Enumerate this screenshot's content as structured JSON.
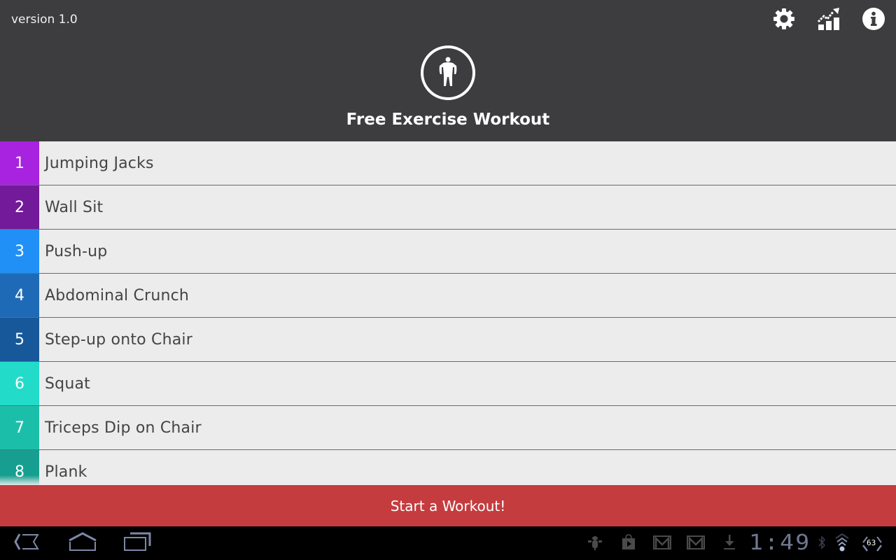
{
  "header": {
    "version": "version 1.0",
    "title": "Free Exercise Workout",
    "icons": [
      "settings-gear-icon",
      "progress-chart-icon",
      "info-icon"
    ],
    "logo_icon": "body-figure-icon",
    "background": "#3d3d3f"
  },
  "exercises": [
    {
      "number": "1",
      "name": "Jumping Jacks",
      "color": "#a723e0"
    },
    {
      "number": "2",
      "name": "Wall Sit",
      "color": "#721a9a"
    },
    {
      "number": "3",
      "name": "Push-up",
      "color": "#2090f7"
    },
    {
      "number": "4",
      "name": "Abdominal Crunch",
      "color": "#1f6ab6"
    },
    {
      "number": "5",
      "name": "Step-up onto Chair",
      "color": "#17589a"
    },
    {
      "number": "6",
      "name": "Squat",
      "color": "#22dbc8"
    },
    {
      "number": "7",
      "name": "Triceps Dip on Chair",
      "color": "#1bbfa9"
    },
    {
      "number": "8",
      "name": "Plank",
      "color": "#169f90"
    }
  ],
  "start_button": {
    "label": "Start a Workout!",
    "color": "#c43c3e"
  },
  "system_bar": {
    "nav": [
      "back-icon",
      "home-icon",
      "recent-apps-icon"
    ],
    "notifications": [
      "android-debug-icon",
      "play-store-icon",
      "gmail-icon",
      "gmail-icon",
      "download-icon"
    ],
    "time": "1:49",
    "battery": "63",
    "status_icons": [
      "bluetooth-icon",
      "wifi-icon",
      "battery-icon"
    ]
  }
}
